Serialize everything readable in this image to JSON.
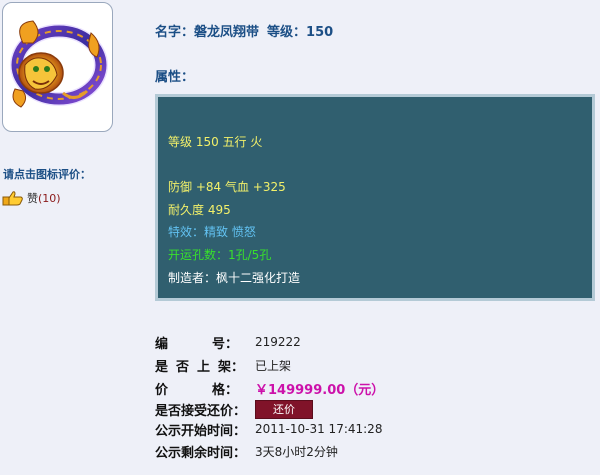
{
  "item": {
    "name_label": "名字：",
    "name": "磐龙凤翔带",
    "level_label": "等级：",
    "level": "150"
  },
  "rating": {
    "prompt": "请点击图标评价：",
    "like_label": "赞",
    "like_count": "(10)"
  },
  "attributes": {
    "title": "属性：",
    "lines": [
      "等级 150 五行 火",
      "防御 +84 气血 +325",
      "耐久度 495",
      "特效：精致 愤怒",
      "开运孔数：1孔/5孔",
      "制造者：枫十二强化打造"
    ]
  },
  "details": {
    "serial_label": [
      "编",
      "号："
    ],
    "serial": "219222",
    "listed_label": [
      "是",
      "否",
      "上",
      "架："
    ],
    "listed": "已上架",
    "price_label": [
      "价",
      "格："
    ],
    "price": "￥149999.00（元）",
    "counter_label": "是否接受还价：",
    "counter_button": "还价",
    "start_label": "公示开始时间：",
    "start_time": "2011-10-31 17:41:28",
    "remaining_label": "公示剩余时间：",
    "remaining": "3天8小时2分钟"
  },
  "colors": {
    "attr_bg": "#305f6f",
    "yellow_text": "#f2f06a",
    "blue_text": "#62c2f2",
    "green_text": "#38e02c",
    "price": "#cc11aa",
    "button": "#801329",
    "label_blue": "#1c4f86"
  }
}
